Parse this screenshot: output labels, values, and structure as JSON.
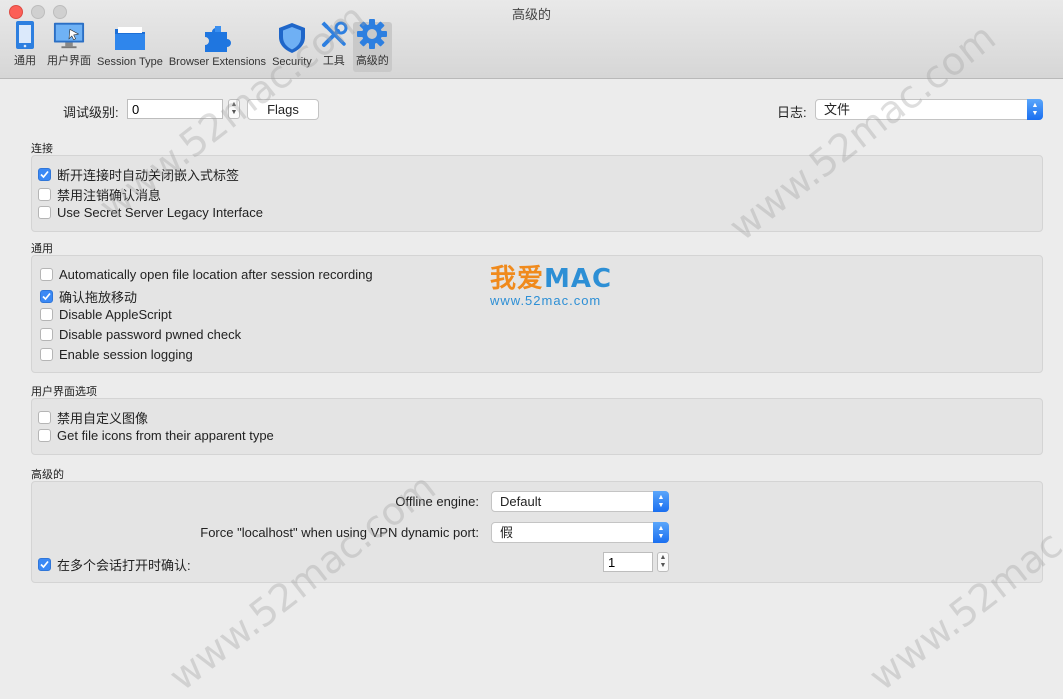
{
  "window": {
    "title": "高级的"
  },
  "toolbar": {
    "items": [
      {
        "label": "通用",
        "icon": "phone-icon"
      },
      {
        "label": "用户界面",
        "icon": "monitor-icon"
      },
      {
        "label": "Session Type",
        "icon": "folder-icon"
      },
      {
        "label": "Browser Extensions",
        "icon": "puzzle-icon"
      },
      {
        "label": "Security",
        "icon": "shield-icon"
      },
      {
        "label": "工具",
        "icon": "tools-icon"
      },
      {
        "label": "高级的",
        "icon": "gear-icon"
      }
    ],
    "active": "高级的"
  },
  "top": {
    "debug_label": "调试级别:",
    "debug_value": "0",
    "flags_label": "Flags",
    "log_label": "日志:",
    "log_value": "文件"
  },
  "sections": {
    "connection": {
      "title": "连接",
      "items": [
        {
          "label": "断开连接时自动关闭嵌入式标签",
          "checked": true
        },
        {
          "label": "禁用注销确认消息",
          "checked": false
        },
        {
          "label": "Use Secret Server Legacy Interface",
          "checked": false
        }
      ]
    },
    "general": {
      "title": "通用",
      "items": [
        {
          "label": "Automatically open file location after session recording",
          "checked": false
        },
        {
          "label": "确认拖放移动",
          "checked": true
        },
        {
          "label": "Disable AppleScript",
          "checked": false
        },
        {
          "label": "Disable password pwned check",
          "checked": false
        },
        {
          "label": "Enable session logging",
          "checked": false
        }
      ]
    },
    "ui": {
      "title": "用户界面选项",
      "items": [
        {
          "label": "禁用自定义图像",
          "checked": false
        },
        {
          "label": "Get file icons from their apparent type",
          "checked": false
        }
      ]
    },
    "advanced": {
      "title": "高级的",
      "offline_label": "Offline engine:",
      "offline_value": "Default",
      "force_label": "Force \"localhost\" when using VPN dynamic port:",
      "force_value": "假",
      "multi_label": "在多个会话打开时确认:",
      "multi_checked": true,
      "multi_value": "1"
    }
  },
  "watermark": {
    "text": "www.52mac.com",
    "logo_cn": "我爱",
    "logo_en": "MAC",
    "logo_url": "www.52mac.com"
  },
  "colors": {
    "accent": "#3b89f5",
    "logo_orange": "#f08a1c",
    "logo_blue": "#2d8fd5"
  }
}
